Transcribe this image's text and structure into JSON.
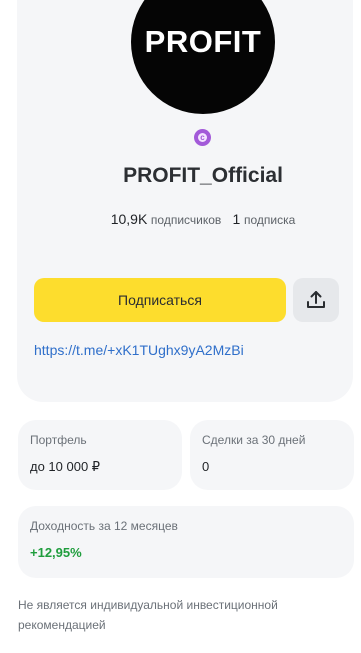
{
  "profile": {
    "avatar_text": "PROFIT",
    "name": "PROFIT_Official",
    "subscribers_count": "10,9K",
    "subscribers_label": "подписчиков",
    "subscriptions_count": "1",
    "subscriptions_label": "подписка",
    "subscribe_label": "Подписаться",
    "share_icon": "share-upload-icon",
    "link": "https://t.me/+xK1TUghx9yA2MzBi",
    "badge_icon": "author-badge-icon",
    "badge_color": "#a35ad9"
  },
  "cards": {
    "portfolio": {
      "label": "Портфель",
      "value": "до 10 000 ₽"
    },
    "deals": {
      "label": "Сделки за 30 дней",
      "value": "0"
    },
    "yield": {
      "label": "Доходность за 12 месяцев",
      "value": "+12,95%"
    }
  },
  "disclaimer": "Не является индивидуальной инвестиционной рекомендацией",
  "colors": {
    "accent_yellow": "#fddd2d",
    "link_blue": "#2f6fca",
    "positive_green": "#1f9d3d"
  }
}
